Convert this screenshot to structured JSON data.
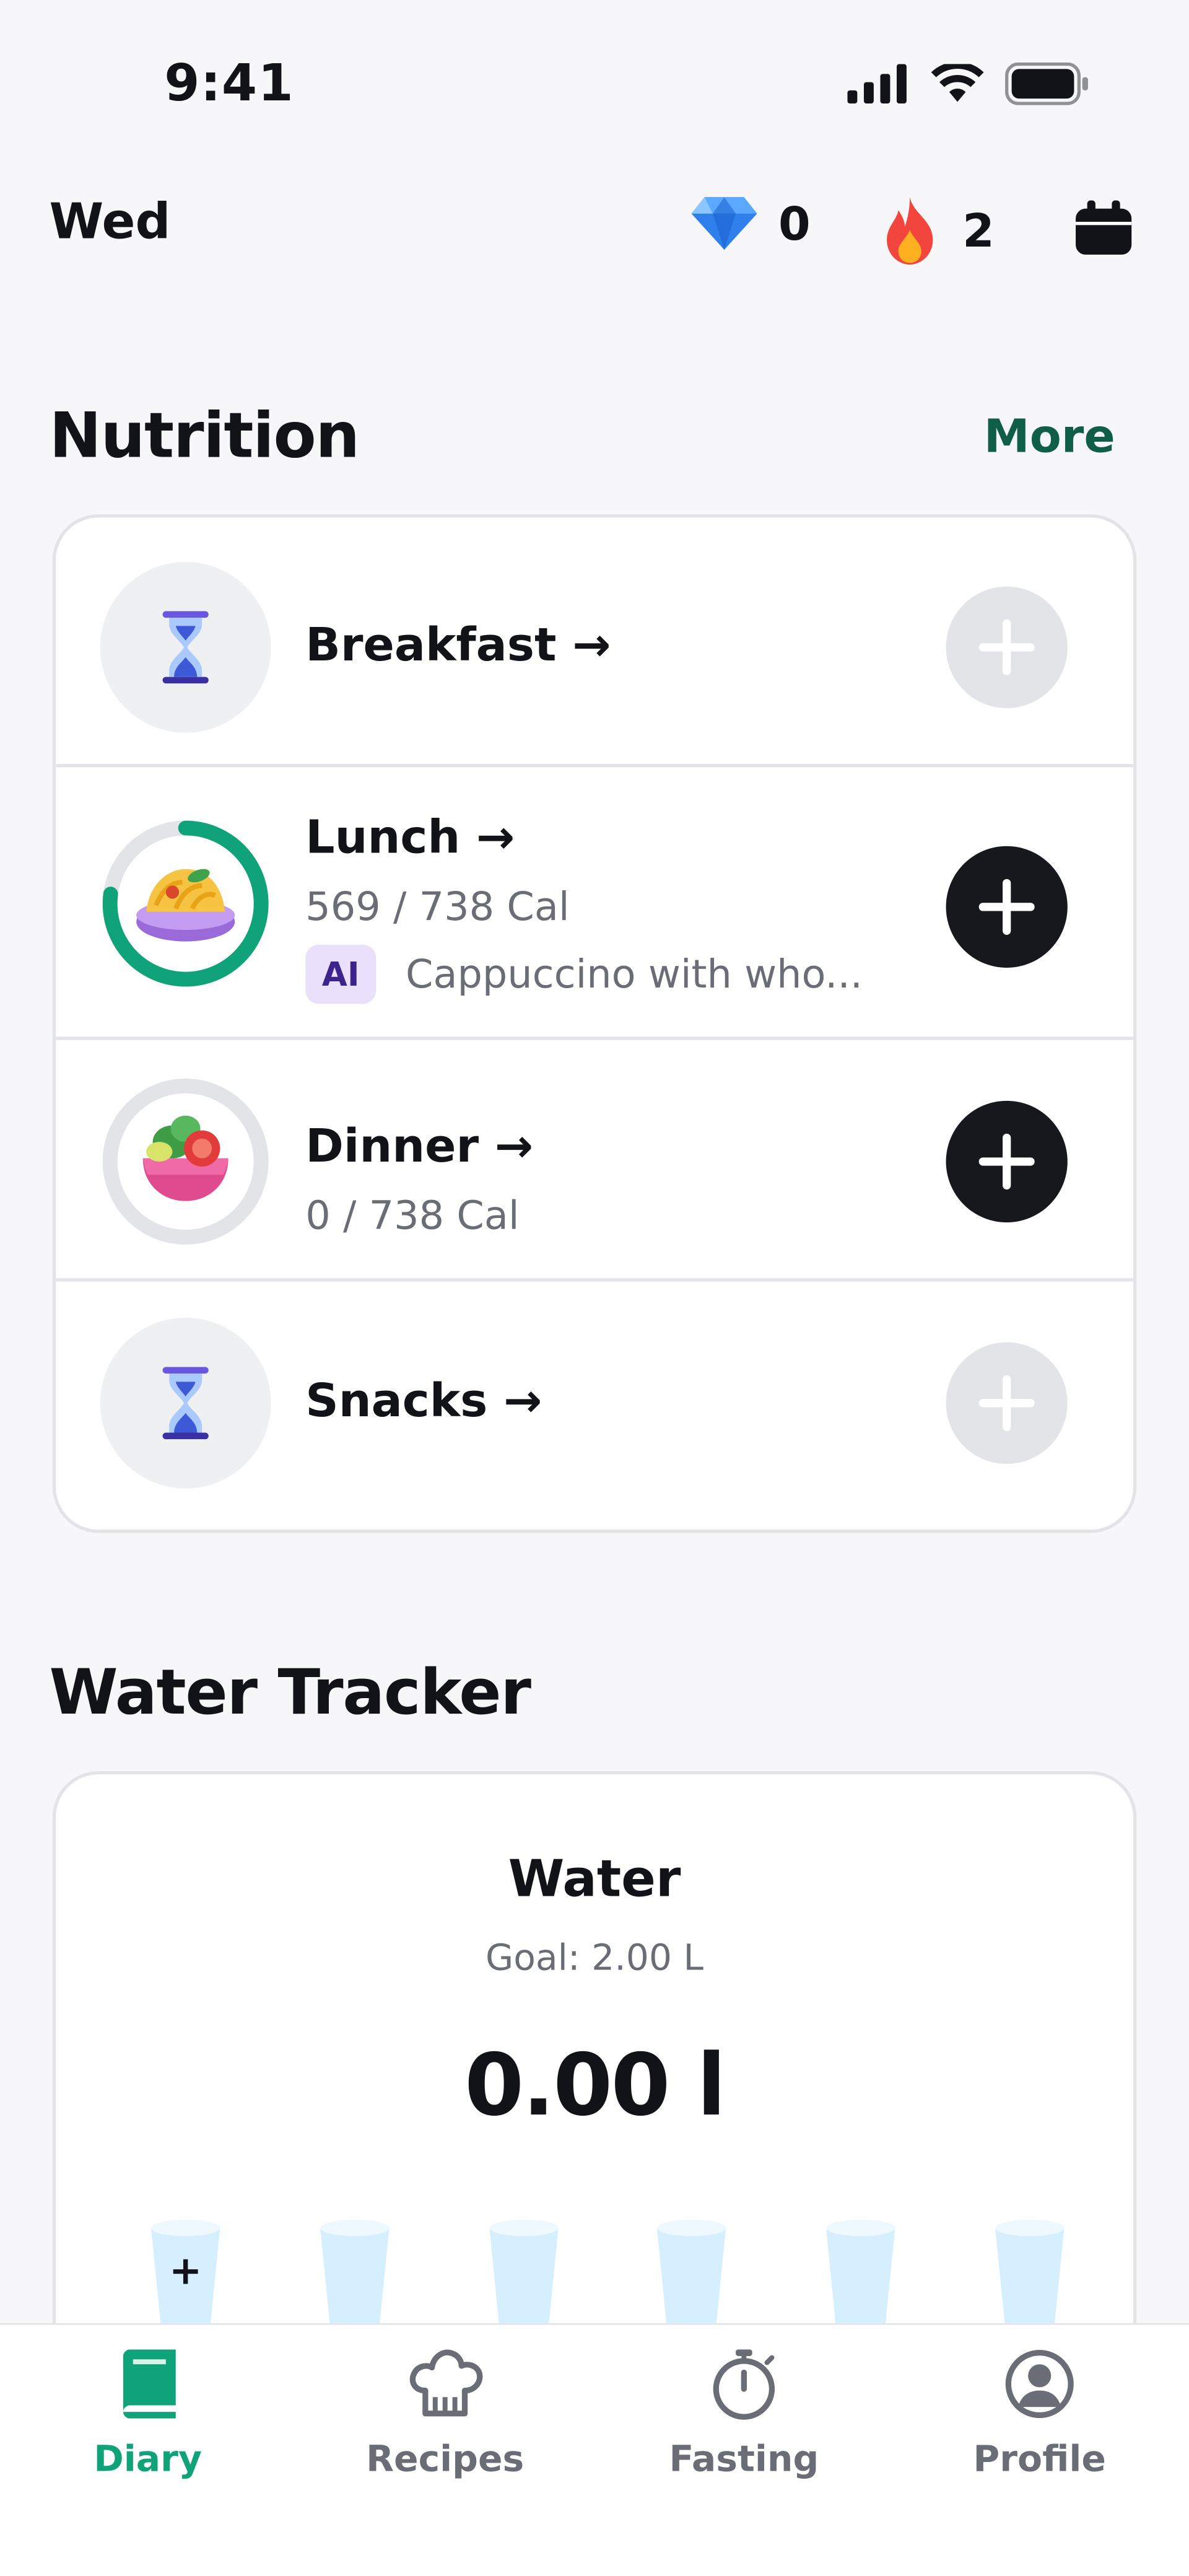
{
  "status_bar": {
    "time": "9:41"
  },
  "header": {
    "day": "Wed",
    "gems_count": "0",
    "streak_count": "2"
  },
  "nutrition": {
    "title": "Nutrition",
    "more_label": "More",
    "meals": [
      {
        "title": "Breakfast →"
      },
      {
        "title": "Lunch →",
        "calories": "569 / 738 Cal",
        "ai_badge": "AI",
        "ai_text": "Cappuccino with who...",
        "progress": 0.77
      },
      {
        "title": "Dinner →",
        "calories": "0 / 738 Cal",
        "progress": 0
      },
      {
        "title": "Snacks →"
      }
    ]
  },
  "water": {
    "section_title": "Water Tracker",
    "title": "Water",
    "goal": "Goal: 2.00 L",
    "amount": "0.00 l",
    "cup_count": 6,
    "add_symbol": "+"
  },
  "tabbar": {
    "tabs": [
      {
        "label": "Diary",
        "icon": "book-icon"
      },
      {
        "label": "Recipes",
        "icon": "chef-hat-icon"
      },
      {
        "label": "Fasting",
        "icon": "stopwatch-icon"
      },
      {
        "label": "Profile",
        "icon": "user-circle-icon"
      }
    ]
  },
  "colors": {
    "accent_green": "#10a37a",
    "more_link": "#0f5e45",
    "ai_badge_bg": "#ebe0fb",
    "dark_button": "#16181d"
  }
}
